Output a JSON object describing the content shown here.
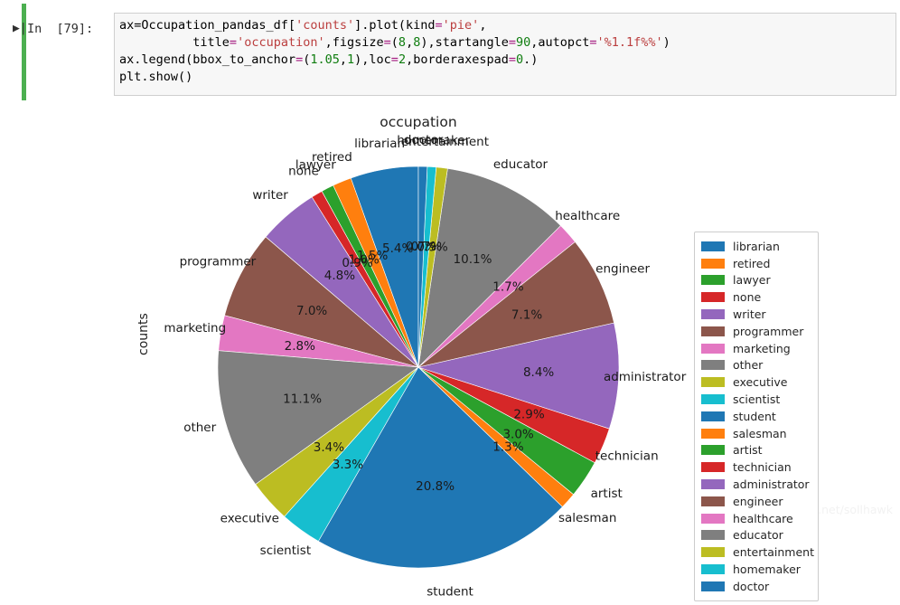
{
  "notebook": {
    "run_glyph": "▶|",
    "prompt_label": "In  [79]:",
    "code_lines": [
      [
        {
          "t": "ax=Occupation_pandas_df",
          "c": "tok-name"
        },
        {
          "t": "[",
          "c": "tok-plain"
        },
        {
          "t": "'counts'",
          "c": "tok-str"
        },
        {
          "t": "]",
          "c": "tok-plain"
        },
        {
          "t": ".plot(kind",
          "c": "tok-name"
        },
        {
          "t": "=",
          "c": "tok-op"
        },
        {
          "t": "'pie'",
          "c": "tok-str"
        },
        {
          "t": ",",
          "c": "tok-plain"
        }
      ],
      [
        {
          "t": "          title",
          "c": "tok-name"
        },
        {
          "t": "=",
          "c": "tok-op"
        },
        {
          "t": "'occupation'",
          "c": "tok-str"
        },
        {
          "t": ",figsize",
          "c": "tok-name"
        },
        {
          "t": "=",
          "c": "tok-op"
        },
        {
          "t": "(",
          "c": "tok-plain"
        },
        {
          "t": "8",
          "c": "tok-num"
        },
        {
          "t": ",",
          "c": "tok-plain"
        },
        {
          "t": "8",
          "c": "tok-num"
        },
        {
          "t": "),startangle",
          "c": "tok-name"
        },
        {
          "t": "=",
          "c": "tok-op"
        },
        {
          "t": "90",
          "c": "tok-num"
        },
        {
          "t": ",autopct",
          "c": "tok-name"
        },
        {
          "t": "=",
          "c": "tok-op"
        },
        {
          "t": "'%1.1f%%'",
          "c": "tok-str"
        },
        {
          "t": ")",
          "c": "tok-plain"
        }
      ],
      [
        {
          "t": "ax.legend(bbox_to_anchor",
          "c": "tok-name"
        },
        {
          "t": "=",
          "c": "tok-op"
        },
        {
          "t": "(",
          "c": "tok-plain"
        },
        {
          "t": "1.05",
          "c": "tok-num"
        },
        {
          "t": ",",
          "c": "tok-plain"
        },
        {
          "t": "1",
          "c": "tok-num"
        },
        {
          "t": "),loc",
          "c": "tok-name"
        },
        {
          "t": "=",
          "c": "tok-op"
        },
        {
          "t": "2",
          "c": "tok-num"
        },
        {
          "t": ",borderaxespad",
          "c": "tok-name"
        },
        {
          "t": "=",
          "c": "tok-op"
        },
        {
          "t": "0",
          "c": "tok-num"
        },
        {
          "t": ".)",
          "c": "tok-plain"
        }
      ],
      [
        {
          "t": "plt.show()",
          "c": "tok-name"
        }
      ]
    ]
  },
  "figure": {
    "title": "occupation",
    "ylabel": "counts",
    "watermark": "https://blog.csdn.net/sollhawk"
  },
  "legend": {
    "entries": [
      {
        "label": "librarian",
        "color": "#1f77b4"
      },
      {
        "label": "retired",
        "color": "#ff7f0e"
      },
      {
        "label": "lawyer",
        "color": "#2ca02c"
      },
      {
        "label": "none",
        "color": "#d62728"
      },
      {
        "label": "writer",
        "color": "#9467bd"
      },
      {
        "label": "programmer",
        "color": "#8c564b"
      },
      {
        "label": "marketing",
        "color": "#e377c2"
      },
      {
        "label": "other",
        "color": "#7f7f7f"
      },
      {
        "label": "executive",
        "color": "#bcbd22"
      },
      {
        "label": "scientist",
        "color": "#17becf"
      },
      {
        "label": "student",
        "color": "#1f77b4"
      },
      {
        "label": "salesman",
        "color": "#ff7f0e"
      },
      {
        "label": "artist",
        "color": "#2ca02c"
      },
      {
        "label": "technician",
        "color": "#d62728"
      },
      {
        "label": "administrator",
        "color": "#9467bd"
      },
      {
        "label": "engineer",
        "color": "#8c564b"
      },
      {
        "label": "healthcare",
        "color": "#e377c2"
      },
      {
        "label": "educator",
        "color": "#7f7f7f"
      },
      {
        "label": "entertainment",
        "color": "#bcbd22"
      },
      {
        "label": "homemaker",
        "color": "#17becf"
      },
      {
        "label": "doctor",
        "color": "#1f77b4"
      }
    ]
  },
  "chart_data": {
    "type": "pie",
    "title": "occupation",
    "ylabel": "counts",
    "startangle": 90,
    "direction": "counterclockwise",
    "autopct": "%1.1f%%",
    "legend_position": "outside-right",
    "labels": [
      "librarian",
      "retired",
      "lawyer",
      "none",
      "writer",
      "programmer",
      "marketing",
      "other",
      "executive",
      "scientist",
      "student",
      "salesman",
      "artist",
      "technician",
      "administrator",
      "engineer",
      "healthcare",
      "educator",
      "entertainment",
      "homemaker",
      "doctor"
    ],
    "percentages": [
      5.4,
      1.5,
      1.0,
      0.9,
      4.8,
      7.0,
      2.8,
      11.1,
      3.4,
      3.3,
      20.8,
      1.3,
      3.0,
      2.9,
      8.4,
      7.1,
      1.7,
      10.1,
      0.9,
      0.7,
      0.7
    ],
    "pct_labels": [
      "5.4%",
      "1.5%",
      "1.0%",
      "0.9%",
      "4.8%",
      "7.0%",
      "2.8%",
      "11.1%",
      "3.4%",
      "3.3%",
      "20.8%",
      "1.3%",
      "3.0%",
      "2.9%",
      "8.4%",
      "7.1%",
      "1.7%",
      "10.1%",
      "0.9%",
      "0.7%",
      "0.7%"
    ],
    "colors": [
      "#1f77b4",
      "#ff7f0e",
      "#2ca02c",
      "#d62728",
      "#9467bd",
      "#8c564b",
      "#e377c2",
      "#7f7f7f",
      "#bcbd22",
      "#17becf",
      "#1f77b4",
      "#ff7f0e",
      "#2ca02c",
      "#d62728",
      "#9467bd",
      "#8c564b",
      "#e377c2",
      "#7f7f7f",
      "#bcbd22",
      "#17becf",
      "#1f77b4"
    ]
  }
}
